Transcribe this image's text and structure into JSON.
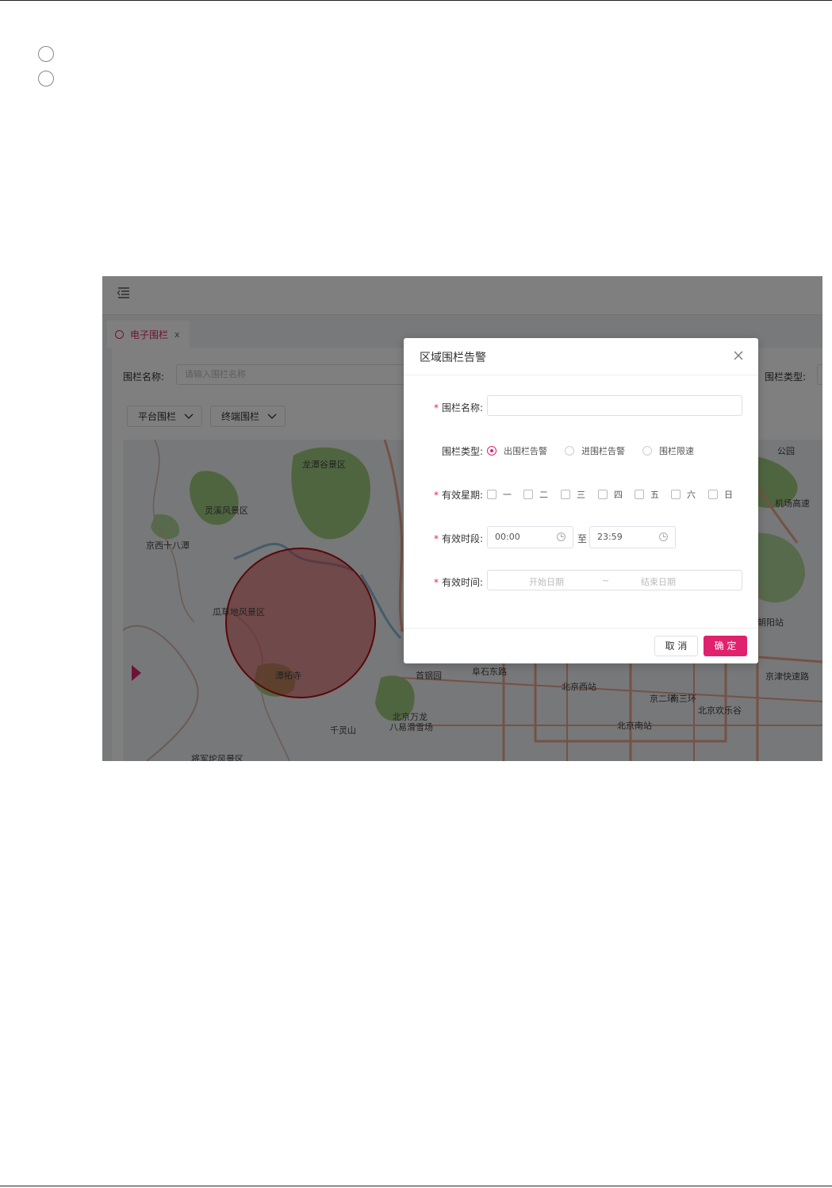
{
  "bg": {
    "menu_icon": "menu-fold-icon",
    "tab": {
      "label": "电子围栏",
      "close": "x"
    },
    "filter": {
      "name_label": "围栏名称:",
      "name_placeholder": "请输入围栏名称",
      "type_label": "围栏类型:"
    },
    "dropdowns": [
      "平台围栏",
      "终端围栏"
    ],
    "map_labels": [
      "龙潭谷景区",
      "灵溪风景区",
      "京西十八潭",
      "瓜草地风景区",
      "潭柘寺",
      "千灵山",
      "北京万龙",
      "八易滑雪场",
      "将军坨风景区",
      "公园",
      "机场高速",
      "朝阳站",
      "京津快速路",
      "北京西站",
      "北京欢乐谷",
      "北京南站",
      "阜石东路",
      "首钢园",
      "京二环",
      "南三环"
    ],
    "colors": {
      "accent": "#e0226e",
      "fence": "#c0392b"
    }
  },
  "dialog": {
    "title": "区域围栏告警",
    "close_icon": "close-icon",
    "fence_name": {
      "label": "围栏名称:",
      "value": ""
    },
    "fence_type": {
      "label": "围栏类型:",
      "options": [
        "出围栏告警",
        "进围栏告警",
        "围栏限速"
      ],
      "selected": "出围栏告警"
    },
    "weekdays": {
      "label": "有效星期:",
      "days": [
        "一",
        "二",
        "三",
        "四",
        "五",
        "六",
        "日"
      ]
    },
    "period": {
      "label": "有效时段:",
      "start": "00:00",
      "to": "至",
      "end": "23:59"
    },
    "valid_time": {
      "label": "有效时间:",
      "start_placeholder": "开始日期",
      "separator": "~",
      "end_placeholder": "结束日期"
    },
    "buttons": {
      "cancel": "取 消",
      "ok": "确 定"
    }
  }
}
